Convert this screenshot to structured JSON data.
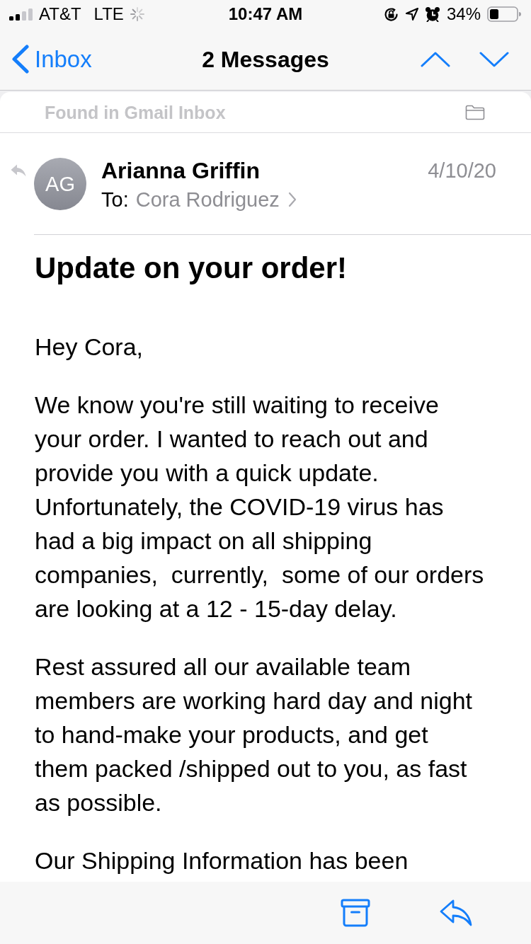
{
  "status_bar": {
    "carrier": "AT&T",
    "network": "LTE",
    "time": "10:47 AM",
    "battery": "34%"
  },
  "nav_bar": {
    "back_label": "Inbox",
    "title": "2 Messages"
  },
  "mailbox_banner": {
    "text": "Found in Gmail Inbox"
  },
  "message": {
    "avatar_initials": "AG",
    "sender": "Arianna Griffin",
    "date": "4/10/20",
    "to_label": "To:",
    "recipient": "Cora Rodriguez",
    "replied": true,
    "subject": "Update on your order!",
    "body": [
      "Hey Cora,",
      "We know you're still waiting to receive your order. I wanted to reach out and provide you with a quick update.  Unfortunately, the COVID-19 virus has had a big impact on all shipping companies,  currently,  some of our orders are looking at a 12 - 15-day delay.",
      "Rest assured all our available team members are working hard day and night to hand-make your products, and get them packed /shipped out to you, as fast as possible.",
      "Our Shipping Information has been"
    ]
  }
}
